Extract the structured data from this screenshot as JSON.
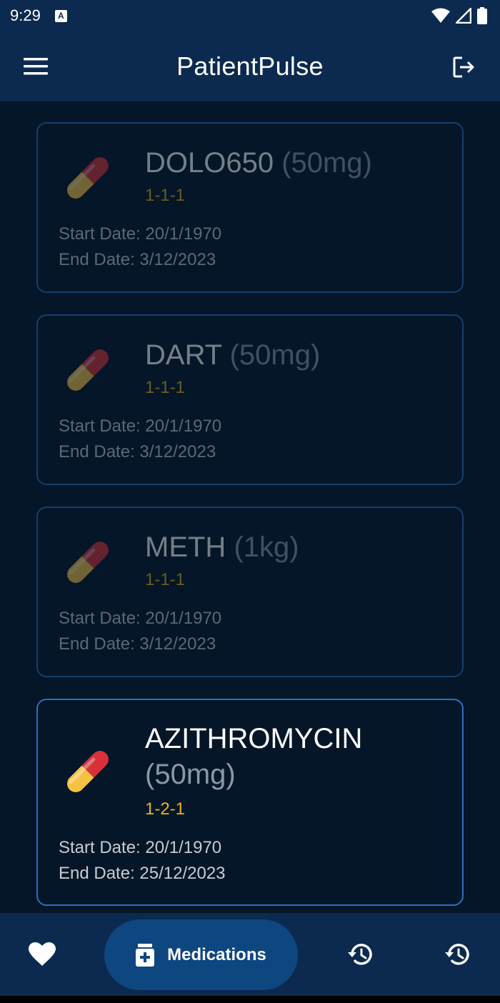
{
  "status_bar": {
    "time": "9:29",
    "a_badge": "A",
    "icons": [
      "wifi-icon",
      "signal-icon",
      "battery-icon"
    ]
  },
  "app_bar": {
    "title": "PatientPulse",
    "menu_icon": "menu-icon",
    "logout_icon": "logout-icon"
  },
  "medications": [
    {
      "name": "DOLO650",
      "dose": "(50mg)",
      "frequency": "1-1-1",
      "start_date": "Start Date: 20/1/1970",
      "end_date": "End Date: 3/12/2023",
      "active": false
    },
    {
      "name": "DART",
      "dose": "(50mg)",
      "frequency": "1-1-1",
      "start_date": "Start Date: 20/1/1970",
      "end_date": "End Date: 3/12/2023",
      "active": false
    },
    {
      "name": "METH",
      "dose": "(1kg)",
      "frequency": "1-1-1",
      "start_date": "Start Date: 20/1/1970",
      "end_date": "End Date: 3/12/2023",
      "active": false
    },
    {
      "name": "AZITHROMYCIN",
      "dose": "(50mg)",
      "frequency": "1-2-1",
      "start_date": "Start Date: 20/1/1970",
      "end_date": "End Date: 25/12/2023",
      "active": true
    }
  ],
  "bottom_nav": {
    "items": [
      {
        "icon": "heart-icon",
        "label": ""
      },
      {
        "icon": "medication-icon",
        "label": "Medications",
        "selected": true
      },
      {
        "icon": "history-icon",
        "label": ""
      },
      {
        "icon": "history-icon",
        "label": ""
      }
    ]
  },
  "colors": {
    "background": "#041627",
    "app_bar": "#0c2a4f",
    "card_border": "#2d6fc2",
    "frequency": "#e8b31d",
    "nav_pill": "#0e4680"
  }
}
